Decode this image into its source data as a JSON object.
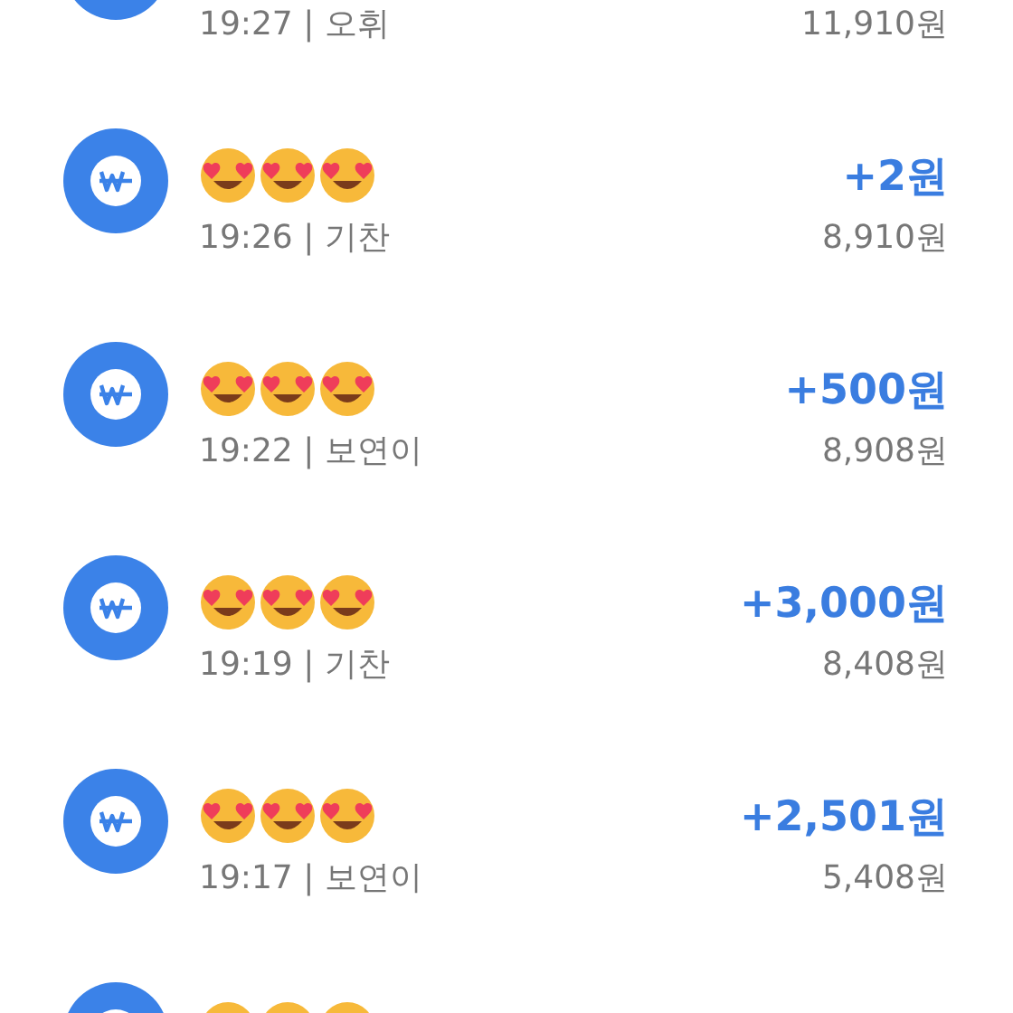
{
  "transactions": [
    {
      "kind": "transaction",
      "meta": "19:27 | 오휘",
      "balance": "11,910원"
    },
    {
      "kind": "transaction",
      "amount": "+2원",
      "meta": "19:26 | 기찬",
      "balance": "8,910원"
    },
    {
      "kind": "transaction",
      "amount": "+500원",
      "meta": "19:22 | 보연이",
      "balance": "8,908원"
    },
    {
      "kind": "transaction",
      "amount": "+3,000원",
      "meta": "19:19 | 기찬",
      "balance": "8,408원"
    },
    {
      "kind": "transaction",
      "amount": "+2,501원",
      "meta": "19:17 | 보연이",
      "balance": "5,408원"
    },
    {
      "kind": "transaction"
    }
  ]
}
